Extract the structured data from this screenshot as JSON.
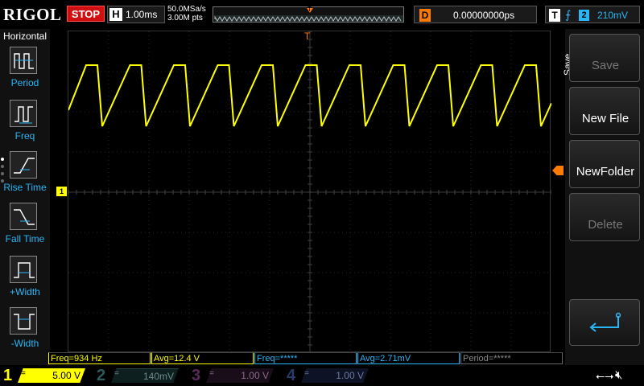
{
  "header": {
    "logo": "RIGOL",
    "run_state": "STOP",
    "horizontal_label": "H",
    "timebase": "1.00ms",
    "sample_rate": "50.0MSa/s",
    "memory_depth": "3.00M pts",
    "trigger_marker": "T",
    "delay_label": "D",
    "delay_value": "0.00000000ps",
    "trigger_label": "T",
    "trigger_edge_icon": "rising-edge-icon",
    "trigger_source": "2",
    "trigger_level": "210mV"
  },
  "left_menu": {
    "title": "Horizontal",
    "items": [
      {
        "label": "Period",
        "icon": "period-icon"
      },
      {
        "label": "Freq",
        "icon": "freq-icon"
      },
      {
        "label": "Rise Time",
        "icon": "rise-time-icon"
      },
      {
        "label": "Fall Time",
        "icon": "fall-time-icon"
      },
      {
        "label": "+Width",
        "icon": "pos-width-icon"
      },
      {
        "label": "-Width",
        "icon": "neg-width-icon"
      }
    ]
  },
  "screen": {
    "ch1_marker": "1",
    "trigger_top_marker": "T",
    "trace_color": "#ffff00",
    "waveform": "sawtooth",
    "cycles_visible": 11
  },
  "right_menu": {
    "title": "Save",
    "keys": [
      {
        "label": "Save",
        "state": "disabled"
      },
      {
        "label": "New File",
        "state": "enabled"
      },
      {
        "label": "NewFolder",
        "state": "enabled"
      },
      {
        "label": "Delete",
        "state": "disabled"
      }
    ],
    "return_icon": "return-arrow-icon"
  },
  "measurements": [
    {
      "text": "Freq=934 Hz",
      "color": "yellow"
    },
    {
      "text": "Avg=12.4 V",
      "color": "yellow"
    },
    {
      "text": "Freq=*****",
      "color": "cyan"
    },
    {
      "text": "Avg=2.71mV",
      "color": "cyan"
    },
    {
      "text": "Period=*****",
      "color": "gray"
    }
  ],
  "channels": [
    {
      "num": "1",
      "coupling": "=",
      "scale": "5.00 V"
    },
    {
      "num": "2",
      "coupling": "=",
      "scale": "140mV"
    },
    {
      "num": "3",
      "coupling": "=",
      "scale": "1.00 V"
    },
    {
      "num": "4",
      "coupling": "=",
      "scale": "1.00 V"
    }
  ],
  "status_icons": [
    "usb-icon",
    "speaker-mute-icon"
  ]
}
